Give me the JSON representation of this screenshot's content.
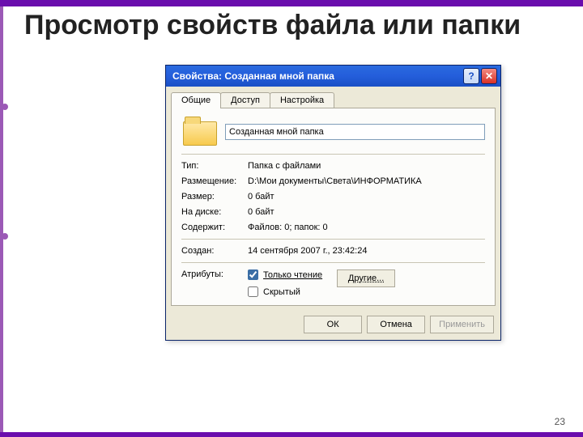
{
  "slide": {
    "title": "Просмотр свойств файла или папки",
    "page_number": "23"
  },
  "dialog": {
    "title": "Свойства: Созданная мной папка",
    "help_glyph": "?",
    "close_glyph": "✕",
    "tabs": [
      "Общие",
      "Доступ",
      "Настройка"
    ],
    "name_value": "Созданная мной папка",
    "props": {
      "type_label": "Тип:",
      "type_value": "Папка с файлами",
      "location_label": "Размещение:",
      "location_value": "D:\\Мои документы\\Света\\ИНФОРМАТИКА",
      "size_label": "Размер:",
      "size_value": "0 байт",
      "ondisk_label": "На диске:",
      "ondisk_value": "0 байт",
      "contains_label": "Содержит:",
      "contains_value": "Файлов: 0; папок: 0",
      "created_label": "Создан:",
      "created_value": "14 сентября 2007 г., 23:42:24",
      "attrs_label": "Атрибуты:"
    },
    "attrs": {
      "readonly_label": "Только чтение",
      "readonly_checked": true,
      "hidden_label": "Скрытый",
      "hidden_checked": false,
      "other_btn": "Другие..."
    },
    "buttons": {
      "ok": "ОК",
      "cancel": "Отмена",
      "apply": "Применить"
    }
  }
}
